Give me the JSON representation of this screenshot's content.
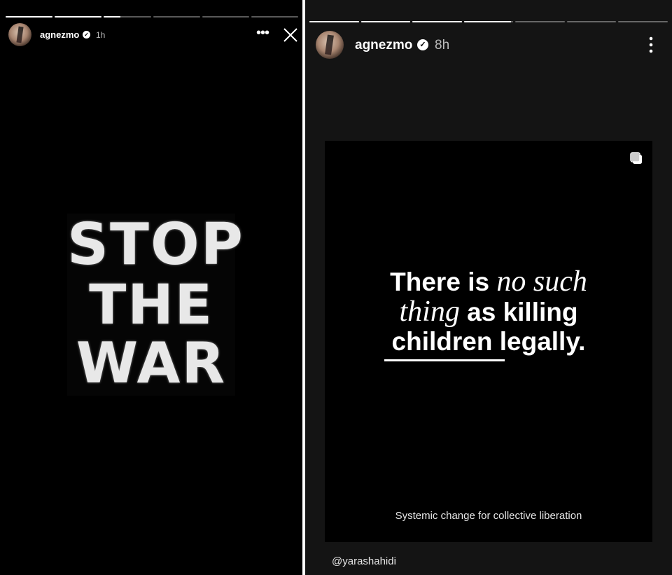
{
  "left_story": {
    "progress": [
      1,
      1,
      0.35,
      0,
      0,
      0
    ],
    "username": "agnezmo",
    "time": "1h",
    "art_lines": [
      "STOP",
      "THE",
      "WAR"
    ]
  },
  "right_story": {
    "progress": [
      1,
      1,
      1,
      0.95,
      0,
      0,
      0
    ],
    "username": "agnezmo",
    "time": "8h",
    "quote": {
      "part1": "There is ",
      "italic1": "no such",
      "italic2": "thing",
      "part2": " as killing",
      "part3": "children legally."
    },
    "tagline": "Systemic change for collective liberation",
    "mention": "@yarashahidi"
  },
  "icons": {
    "more": "more-horizontal-icon",
    "close": "close-icon",
    "more_vertical": "more-vertical-icon",
    "verified": "verified-badge-icon",
    "carousel": "carousel-icon"
  }
}
